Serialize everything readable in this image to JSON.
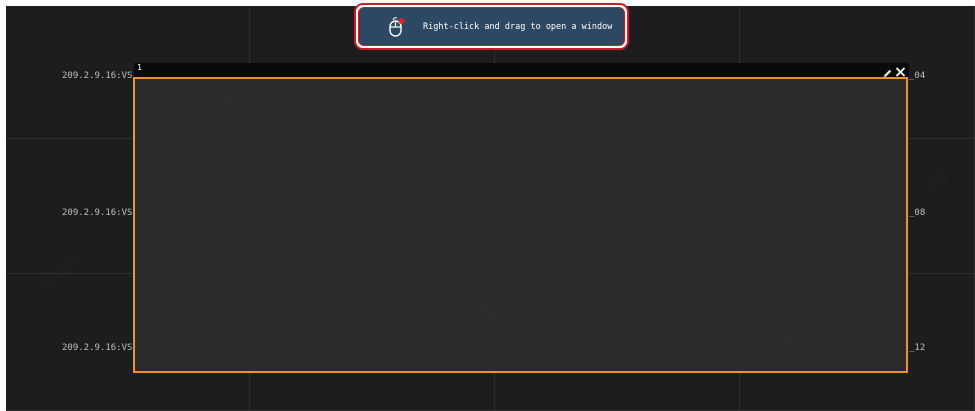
{
  "tooltip": {
    "text": "Right-click and drag to open a window",
    "icon": "mouse-right-click-icon"
  },
  "window": {
    "number": "1",
    "edit_icon": "pencil-icon",
    "close_icon": "close-icon",
    "border_color": "#f0902a"
  },
  "wall": {
    "left_labels": [
      "209.2.9.16:VS",
      "209.2.9.16:VS",
      "209.2.9.16:VS"
    ],
    "right_labels": [
      "_04",
      "_08",
      "_12"
    ]
  },
  "colors": {
    "tooltip_bg": "#2c4863",
    "tooltip_border": "#c0202a",
    "wall_bg": "#1a1a1a"
  }
}
